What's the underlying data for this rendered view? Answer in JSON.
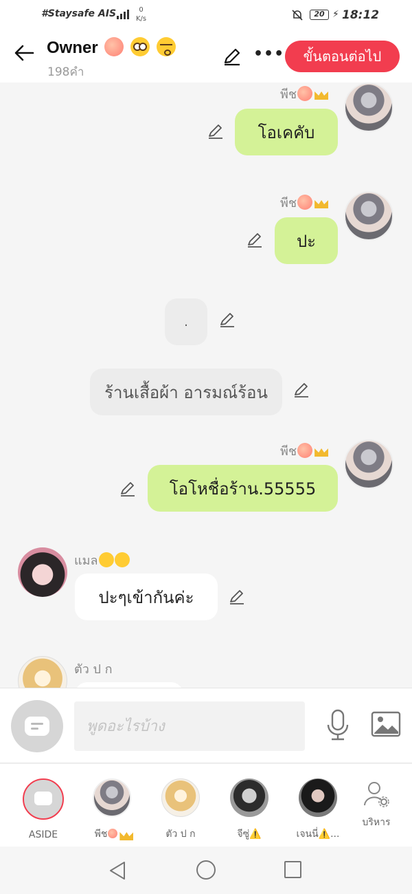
{
  "status_bar": {
    "carrier": "#Staysafe AIS",
    "network": "4G",
    "net_speed_value": "0",
    "net_speed_unit": "K/s",
    "battery": "20",
    "time": "18:12"
  },
  "header": {
    "title": "Owner",
    "subtitle": "198คำ",
    "next_button": "ขั้นตอนต่อไป"
  },
  "messages": [
    {
      "sender": "พีช",
      "text": "โอเคคับ",
      "style": "green",
      "side": "right"
    },
    {
      "sender": "พีช",
      "text": "ปะ",
      "style": "green",
      "side": "right"
    },
    {
      "sender": "",
      "text": ".",
      "style": "gray",
      "side": "center"
    },
    {
      "sender": "",
      "text": "ร้านเสื้อผ้า อารมณ์ร้อน",
      "style": "gray",
      "side": "center"
    },
    {
      "sender": "พีช",
      "text": "โอโหชื่อร้าน.55555",
      "style": "green",
      "side": "right"
    },
    {
      "sender": "แมล",
      "text": "ปะๆเข้ากันค่ะ",
      "style": "white",
      "side": "left"
    },
    {
      "sender": "ตัว ป ก",
      "text": "",
      "style": "white",
      "side": "left"
    }
  ],
  "input": {
    "placeholder": "พูดอะไรบ้าง"
  },
  "members": [
    {
      "label": "ASIDE"
    },
    {
      "label": "พีช"
    },
    {
      "label": "ตัว ป ก"
    },
    {
      "label": "จีซู่⚠️"
    },
    {
      "label": "เจนนี่⚠️..."
    },
    {
      "label": "บริหาร"
    }
  ],
  "icons": {
    "back": "arrow-left-icon",
    "edit": "pencil-icon",
    "more": "more-dots-icon",
    "mic": "microphone-icon",
    "image": "image-icon",
    "admin": "user-gear-icon"
  },
  "colors": {
    "accent": "#f23d4f",
    "bubble_green": "#d4f297",
    "bubble_gray": "#ececec"
  }
}
